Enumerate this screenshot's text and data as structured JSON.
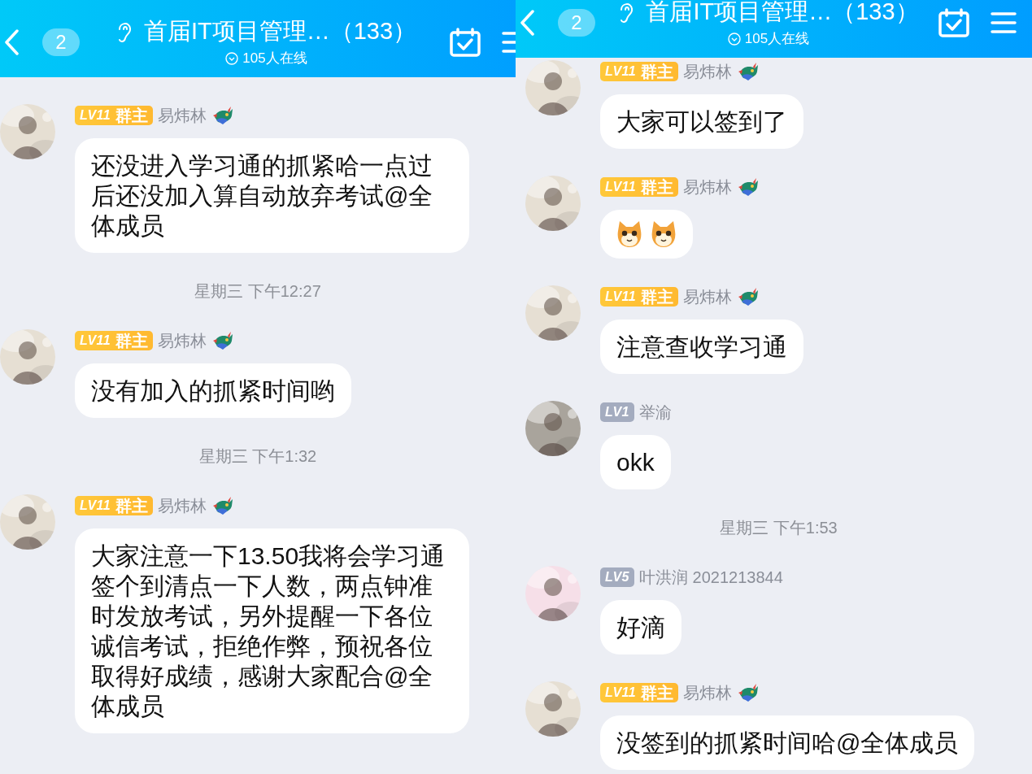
{
  "panels": [
    {
      "header": {
        "unread": "2",
        "title": "首届IT项目管理…（133）",
        "online": "105人在线"
      },
      "items": [
        {
          "kind": "message",
          "sender": {
            "name": "易炜林",
            "badge": {
              "kind": "owner",
              "level": "LV11",
              "role": "群主"
            },
            "medal": true
          },
          "text": "还没进入学习通的抓紧哈一点过后还没加入算自动放弃考试@全体成员"
        },
        {
          "kind": "time",
          "text": "星期三 下午12:27"
        },
        {
          "kind": "message",
          "sender": {
            "name": "易炜林",
            "badge": {
              "kind": "owner",
              "level": "LV11",
              "role": "群主"
            },
            "medal": true
          },
          "text": "没有加入的抓紧时间哟"
        },
        {
          "kind": "time",
          "text": "星期三 下午1:32"
        },
        {
          "kind": "message",
          "sender": {
            "name": "易炜林",
            "badge": {
              "kind": "owner",
              "level": "LV11",
              "role": "群主"
            },
            "medal": true
          },
          "text": "大家注意一下13.50我将会学习通签个到清点一下人数，两点钟准时发放考试，另外提醒一下各位诚信考试，拒绝作弊，预祝各位取得好成绩，感谢大家配合@全体成员"
        }
      ]
    },
    {
      "header": {
        "unread": "2",
        "title": "首届IT项目管理…（133）",
        "online": "105人在线"
      },
      "items": [
        {
          "kind": "message",
          "sender": {
            "name": "易炜林",
            "badge": {
              "kind": "owner",
              "level": "LV11",
              "role": "群主"
            },
            "medal": true
          },
          "text": "大家可以签到了"
        },
        {
          "kind": "message",
          "sender": {
            "name": "易炜林",
            "badge": {
              "kind": "owner",
              "level": "LV11",
              "role": "群主"
            },
            "medal": true
          },
          "stickers": [
            {
              "kind": "cat"
            },
            {
              "kind": "cat"
            }
          ]
        },
        {
          "kind": "message",
          "sender": {
            "name": "易炜林",
            "badge": {
              "kind": "owner",
              "level": "LV11",
              "role": "群主"
            },
            "medal": true
          },
          "text": "注意查收学习通"
        },
        {
          "kind": "message",
          "sender": {
            "name": "举渝",
            "badge": {
              "kind": "member",
              "level": "LV1"
            },
            "medal": false
          },
          "text": "okk"
        },
        {
          "kind": "time",
          "text": "星期三 下午1:53"
        },
        {
          "kind": "message",
          "sender": {
            "name": "叶洪润 2021213844",
            "badge": {
              "kind": "member",
              "level": "LV5"
            },
            "medal": false
          },
          "text": "好滴"
        },
        {
          "kind": "message",
          "sender": {
            "name": "易炜林",
            "badge": {
              "kind": "owner",
              "level": "LV11",
              "role": "群主"
            },
            "medal": true
          },
          "text": "没签到的抓紧时间哈@全体成员"
        }
      ]
    }
  ]
}
